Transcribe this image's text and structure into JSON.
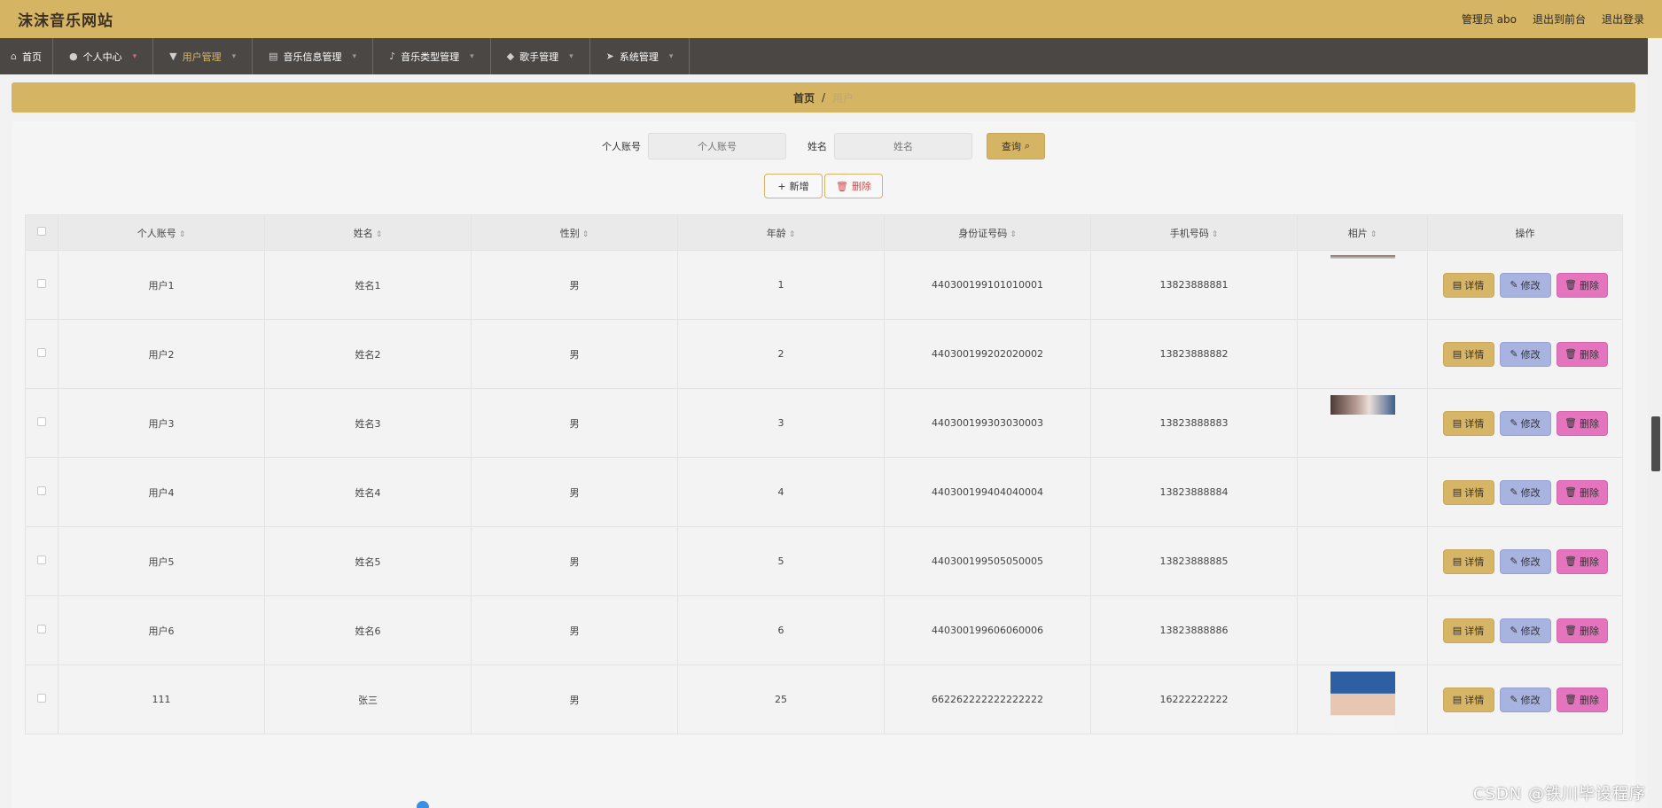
{
  "header": {
    "logo": "沫沫音乐网站",
    "admin": "管理员 abo",
    "to_front": "退出到前台",
    "logout": "退出登录"
  },
  "nav": [
    {
      "label": "首页",
      "icon": "home-icon"
    },
    {
      "label": "个人中心",
      "icon": "user-icon"
    },
    {
      "label": "用户管理",
      "icon": "users-icon"
    },
    {
      "label": "音乐信息管理",
      "icon": "document-icon"
    },
    {
      "label": "音乐类型管理",
      "icon": "mic-icon"
    },
    {
      "label": "歌手管理",
      "icon": "location-icon"
    },
    {
      "label": "系统管理",
      "icon": "send-icon"
    }
  ],
  "breadcrumb": {
    "home": "首页",
    "sep": "/",
    "current": "用户"
  },
  "search": {
    "account_label": "个人账号",
    "account_placeholder": "个人账号",
    "name_label": "姓名",
    "name_placeholder": "姓名",
    "query": "查询"
  },
  "actions": {
    "add": "新增",
    "delete": "删除"
  },
  "table": {
    "headers": [
      "个人账号",
      "姓名",
      "性别",
      "年龄",
      "身份证号码",
      "手机号码",
      "相片",
      "操作"
    ],
    "rows": [
      {
        "account": "用户1",
        "name": "姓名1",
        "gender": "男",
        "age": "1",
        "id": "440300199101010001",
        "phone": "13823888881"
      },
      {
        "account": "用户2",
        "name": "姓名2",
        "gender": "男",
        "age": "2",
        "id": "440300199202020002",
        "phone": "13823888882"
      },
      {
        "account": "用户3",
        "name": "姓名3",
        "gender": "男",
        "age": "3",
        "id": "440300199303030003",
        "phone": "13823888883"
      },
      {
        "account": "用户4",
        "name": "姓名4",
        "gender": "男",
        "age": "4",
        "id": "440300199404040004",
        "phone": "13823888884"
      },
      {
        "account": "用户5",
        "name": "姓名5",
        "gender": "男",
        "age": "5",
        "id": "440300199505050005",
        "phone": "13823888885"
      },
      {
        "account": "用户6",
        "name": "姓名6",
        "gender": "男",
        "age": "6",
        "id": "440300199606060006",
        "phone": "13823888886"
      },
      {
        "account": "111",
        "name": "张三",
        "gender": "男",
        "age": "25",
        "id": "662262222222222222",
        "phone": "16222222222"
      }
    ],
    "row_ops": {
      "detail": "详情",
      "edit": "修改",
      "delete": "删除"
    }
  },
  "watermark": "CSDN @铁川毕设程序",
  "colors": {
    "primary": "#d5b463",
    "nav_bg": "#4a4745",
    "edit": "#a9b3e0",
    "delete": "#e374bd"
  }
}
